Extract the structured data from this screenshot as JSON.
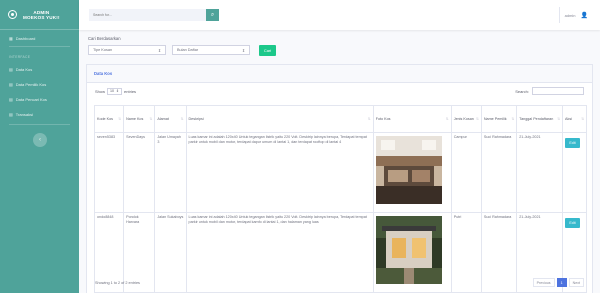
{
  "sidebar": {
    "brand_line1": "ADMIN",
    "brand_line2": "MOEKOS YUK!!",
    "dashboard": "Dashboard",
    "heading": "INTERFACE",
    "items": [
      {
        "label": "Data Kos"
      },
      {
        "label": "Data Pemilik Kos"
      },
      {
        "label": "Data Pencari Kos"
      },
      {
        "label": "Transaksi"
      }
    ],
    "toggle_icon": "chevron-left-icon"
  },
  "topbar": {
    "search_placeholder": "Search for...",
    "search_icon": "search-icon",
    "user_name": "admin",
    "user_icon": "user-icon"
  },
  "filter": {
    "title": "Cari Berdasarkan",
    "type_value": "Tipe Kosan",
    "month_value": "Bulan Daftar",
    "button": "Cari"
  },
  "card": {
    "title": "Data Kos",
    "show": "Show",
    "entries_value": "10",
    "entries": "entries",
    "search_label": "Search:",
    "columns": [
      "Kode Kos",
      "Name Kos",
      "Alamat",
      "Deskripsi",
      "Foto Kos",
      "Jenis Kosan",
      "Name Pemilik",
      "Tanggal Pendaftaran",
      "Aksi"
    ],
    "rows": [
      {
        "kode": "seven5383",
        "name": "SevenDays",
        "alamat": "Jalan Umayah 3",
        "deskripsi": "Luas kamar ini adalah 120x40 Untuk tegangan listrik yaitu 220 Volt. Desktrip lainnya berupa, Terdapat tempat parkir untuk mobil dan motor, terdapat dapur umum di lantai 1, dan terdapat rooftop di lantai 4",
        "jenis": "Campur",
        "pemilik": "Suci Rahmadara",
        "tanggal": "21-July-2021",
        "aksi": "Edit"
      },
      {
        "kode": "ondo8848",
        "name": "Pondok Harvara",
        "alamat": "Jalan Sukaboys",
        "deskripsi": "Luas kamar ini adalah 120x40 Untuk tegangan listrik yaitu 220 Volt. Desktrip lainnya berupa, Terdapat tempat parkir untuk mobil dan motor, terdapat kamfo di lantai 1, dan halaman yang luas",
        "jenis": "Putri",
        "pemilik": "Suci Rahmadara",
        "tanggal": "21-July-2021",
        "aksi": "Edit"
      }
    ],
    "info": "Showing 1 to 2 of 2 entries",
    "prev": "Previous",
    "page": "1",
    "next": "Next"
  }
}
